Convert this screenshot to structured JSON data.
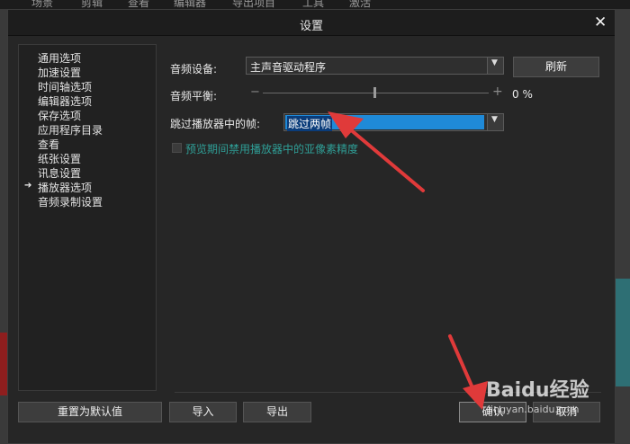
{
  "background_app": {
    "menu": [
      "场景",
      "剪辑",
      "查看",
      "编辑器",
      "导出项目",
      "工具",
      "激活"
    ]
  },
  "dialog": {
    "title": "设置",
    "close_glyph": "✕"
  },
  "sidebar": {
    "active_arrow": "➔",
    "items": [
      {
        "label": "通用选项"
      },
      {
        "label": "加速设置"
      },
      {
        "label": "时间轴选项"
      },
      {
        "label": "编辑器选项"
      },
      {
        "label": "保存选项"
      },
      {
        "label": "应用程序目录"
      },
      {
        "label": "查看"
      },
      {
        "label": "纸张设置"
      },
      {
        "label": "讯息设置"
      },
      {
        "label": "播放器选项"
      },
      {
        "label": "音频录制设置"
      }
    ]
  },
  "settings": {
    "audio_device_label": "音频设备:",
    "audio_device_value": "主声音驱动程序",
    "refresh_label": "刷新",
    "audio_balance_label": "音频平衡:",
    "audio_balance_value": "0 %",
    "slider_minus": "−",
    "slider_plus": "+",
    "skip_frames_label": "跳过播放器中的帧:",
    "skip_frames_value": "跳过两帧",
    "disable_subpixel_label": "预览期间禁用播放器中的亚像素精度"
  },
  "footer": {
    "reset_label": "重置为默认值",
    "import_label": "导入",
    "export_label": "导出",
    "ok_label": "确认",
    "cancel_label": "取消"
  },
  "watermark": {
    "logo": "Baidu经验",
    "url": "jingyan.baidu.com"
  },
  "colors": {
    "selection": "#1f8ad8",
    "annotation_arrow": "#e03a3a",
    "disabled_text": "#2f9f97"
  }
}
